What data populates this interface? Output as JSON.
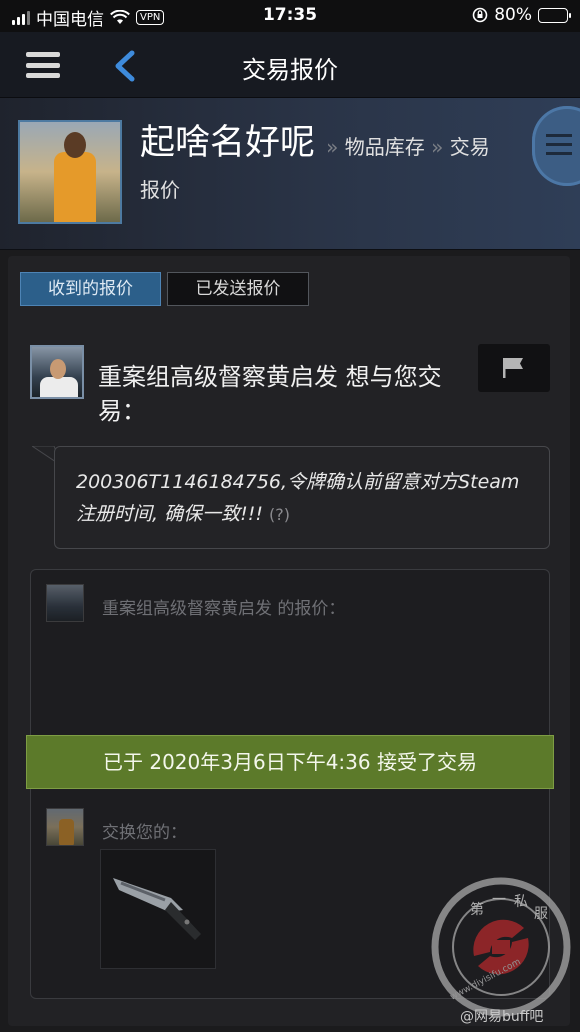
{
  "status_bar": {
    "carrier": "中国电信",
    "vpn": "VPN",
    "time": "17:35",
    "battery": "80%",
    "battery_level": 0.8
  },
  "navbar": {
    "title": "交易报价",
    "menu_icon": "hamburger-icon",
    "back_icon": "chevron-left-icon",
    "back_color": "#3e8bdc"
  },
  "profile": {
    "username": "起啥名好呢",
    "crumb_1": "物品库存",
    "crumb_2_part1": "交易",
    "crumb_2_part2": "报价",
    "separator": "»"
  },
  "tabs": {
    "received": "收到的报价",
    "sent": "已发送报价"
  },
  "offer": {
    "trader_line": "重案组高级督察黄启发 想与您交易：",
    "message": "200306T1146184756,令牌确认前留意对方Steam注册时间, 确保一致!!!",
    "help": "(?)",
    "their_offer_label": "重案组高级督察黄启发 的报价：",
    "status_banner": "已于 2020年3月6日下午4:36 接受了交易",
    "your_items_label": "交换您的：",
    "item_icon": "knife-icon"
  },
  "colors": {
    "accent_blue": "#2c5f8a",
    "accepted_green": "#5c7a2a",
    "background": "#1b1b1d"
  },
  "watermark": {
    "chars": [
      "第",
      "一",
      "私",
      "服"
    ],
    "caption": "@网易buff吧",
    "url_text": "www.diyisifu.com"
  }
}
